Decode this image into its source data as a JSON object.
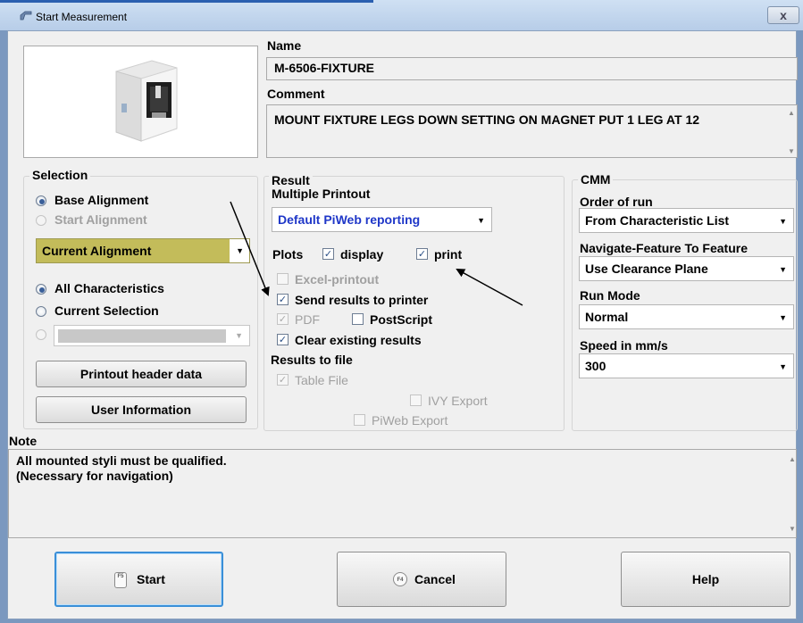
{
  "window": {
    "title": "Start Measurement",
    "close_label": "x"
  },
  "name": {
    "label": "Name",
    "value": "M-6506-FIXTURE"
  },
  "comment": {
    "label": "Comment",
    "value": "MOUNT FIXTURE LEGS DOWN SETTING ON MAGNET PUT 1 LEG AT 12"
  },
  "selection": {
    "title": "Selection",
    "base_alignment": "Base Alignment",
    "start_alignment": "Start Alignment",
    "alignment_value": "Current Alignment",
    "all_characteristics": "All Characteristics",
    "current_selection": "Current Selection",
    "printout_header_button": "Printout header data",
    "user_information_button": "User Information"
  },
  "result": {
    "title": "Result",
    "multiple_printout": "Multiple Printout",
    "printout_value": "Default PiWeb reporting",
    "plots": "Plots",
    "display": "display",
    "print": "print",
    "excel_printout": "Excel-printout",
    "send_to_printer": "Send results to printer",
    "pdf": "PDF",
    "postscript": "PostScript",
    "clear_results": "Clear existing results",
    "results_to_file": "Results to file",
    "table_file": "Table File",
    "ivy_export": "IVY Export",
    "piweb_export": "PiWeb Export"
  },
  "cmm": {
    "title": "CMM",
    "order_label": "Order of run",
    "order_value": "From Characteristic List",
    "navigate_label": "Navigate-Feature To Feature",
    "navigate_value": "Use Clearance Plane",
    "runmode_label": "Run Mode",
    "runmode_value": "Normal",
    "speed_label": "Speed in mm/s",
    "speed_value": "300"
  },
  "note": {
    "label": "Note",
    "line1": "All mounted styli must be qualified.",
    "line2": "(Necessary for navigation)"
  },
  "buttons": {
    "start": "Start",
    "start_key": "F5",
    "cancel": "Cancel",
    "cancel_key": "F4",
    "help": "Help"
  },
  "colors": {
    "alignment_highlight": "#c3bc5a",
    "link_blue": "#1f37c8",
    "title_gradient_top": "#cfe0f3"
  }
}
